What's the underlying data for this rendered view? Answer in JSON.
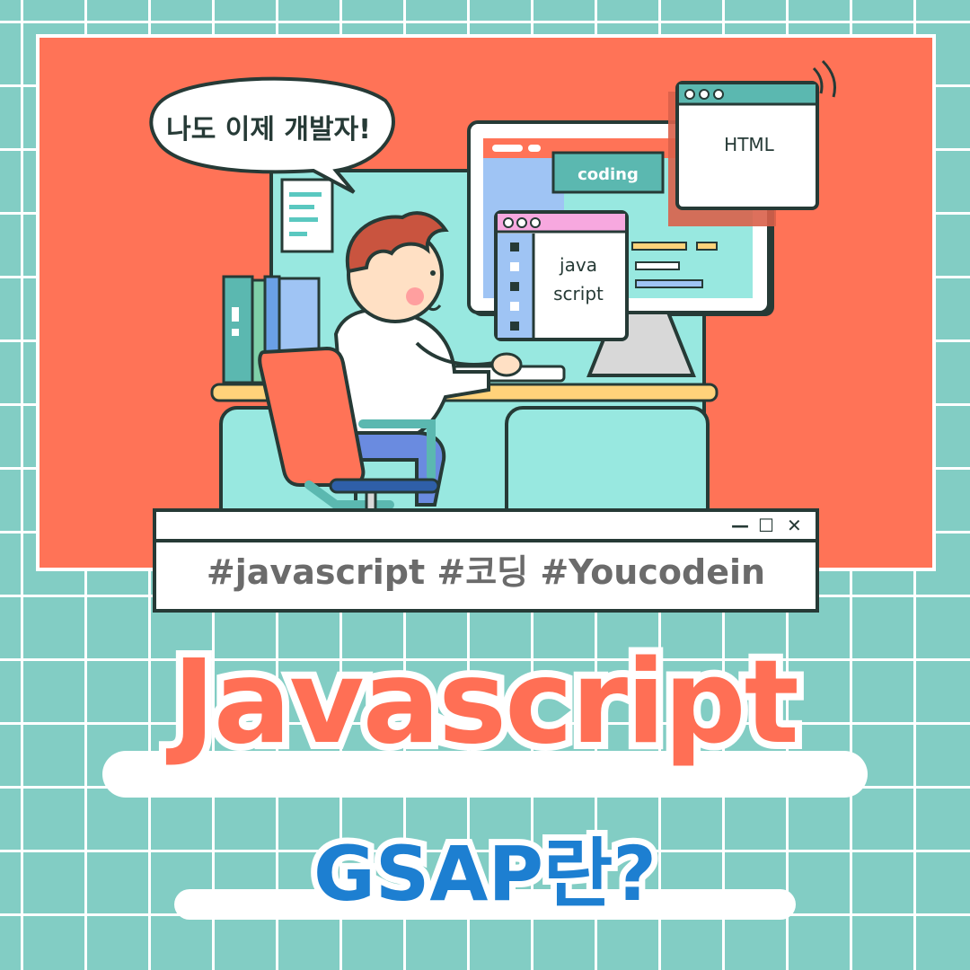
{
  "illustration": {
    "speech_bubble": "나도 이제 개발자!",
    "window_html": "HTML",
    "window_coding": "coding",
    "window_js_line1": "java",
    "window_js_line2": "script"
  },
  "hashtag_window": {
    "text": "#javascript #코딩 #Youcodein",
    "minimize_icon": "minimize-icon",
    "maximize_icon": "maximize-icon",
    "close_icon": "close-icon"
  },
  "title": {
    "main": "Javascript",
    "sub": "GSAP란?"
  },
  "colors": {
    "grid_bg": "#82cdc4",
    "hero_bg": "#ff7357",
    "title_main": "#ff6f55",
    "title_sub": "#1d7fd1"
  }
}
